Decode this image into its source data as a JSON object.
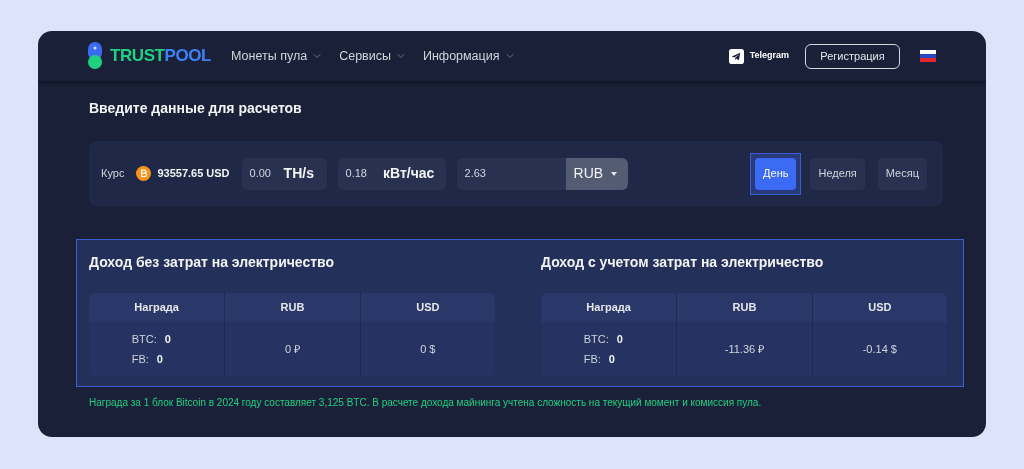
{
  "header": {
    "logo": {
      "first": "TRUST",
      "second": "POOL"
    },
    "nav": [
      {
        "label": "Монеты пула"
      },
      {
        "label": "Сервисы"
      },
      {
        "label": "Информация"
      }
    ],
    "telegram": "Telegram",
    "register": "Регистрация"
  },
  "title": "Введите данные для расчетов",
  "inputs": {
    "rate_label": "Курс",
    "rate_value": "93557.65 USD",
    "hashrate": {
      "value": "0.00",
      "unit": "TH/s"
    },
    "power": {
      "value": "0.18",
      "unit": "кВт/час"
    },
    "price": {
      "value": "2.63",
      "currency": "RUB"
    }
  },
  "periods": [
    {
      "label": "День",
      "selected": true
    },
    {
      "label": "Неделя",
      "selected": false
    },
    {
      "label": "Месяц",
      "selected": false
    }
  ],
  "results": [
    {
      "title": "Доход без затрат на электричество",
      "columns": [
        "Награда",
        "RUB",
        "USD"
      ],
      "rewards": [
        {
          "label": "BTC:",
          "value": "0"
        },
        {
          "label": "FB:",
          "value": "0"
        }
      ],
      "rub": "0 ₽",
      "usd": "0 $"
    },
    {
      "title": "Доход с учетом затрат на электричество",
      "columns": [
        "Награда",
        "RUB",
        "USD"
      ],
      "rewards": [
        {
          "label": "BTC:",
          "value": "0"
        },
        {
          "label": "FB:",
          "value": "0"
        }
      ],
      "rub": "-11.36 ₽",
      "usd": "-0.14 $"
    }
  ],
  "note": "Награда за 1 блок Bitcoin в 2024 году составляет 3,125 BTC. В расчете дохода майнинга учтена сложность на текущий момент и комиссия пула."
}
